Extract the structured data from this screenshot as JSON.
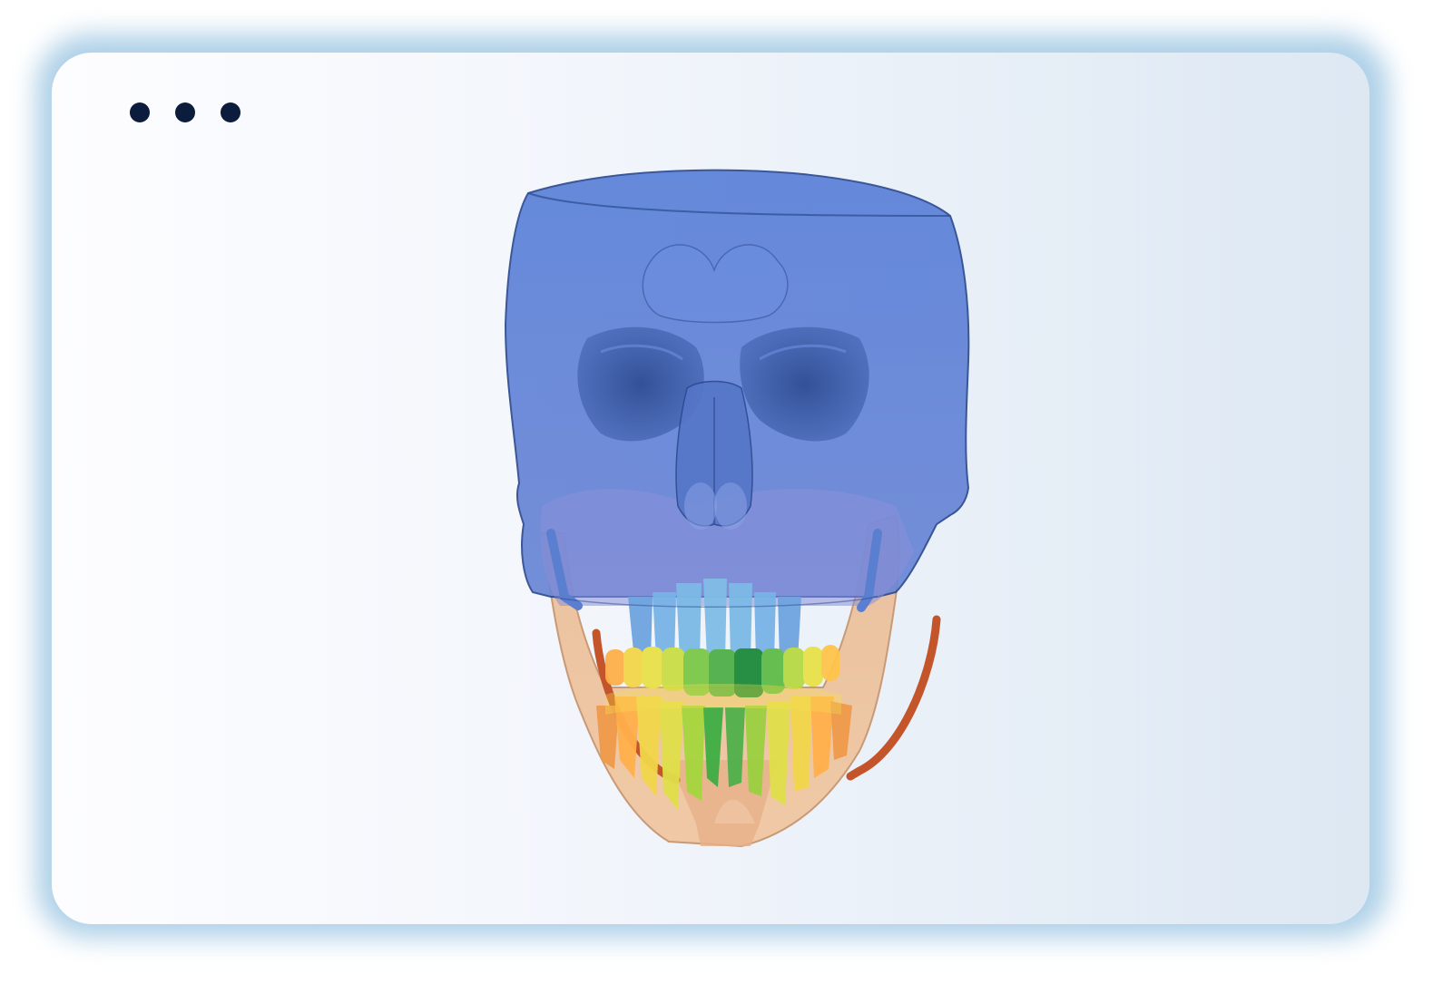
{
  "window": {
    "controls": [
      "menu-dot",
      "menu-dot",
      "menu-dot"
    ]
  },
  "colors": {
    "skull": "#4f76d4",
    "skull_dark": "#2c4a8f",
    "mandible": "#e8b48a",
    "nerve_canal": "#c4552a",
    "teeth_gradient": [
      "#ffb04a",
      "#f2e34a",
      "#a6d63e",
      "#3fae44",
      "#1c8a3a"
    ],
    "window_border": "#a9cde6",
    "dot_color": "#0c1c3c"
  },
  "viewer": {
    "subject": "3d-skull-segmentation",
    "icon": "skull-3d-model"
  }
}
